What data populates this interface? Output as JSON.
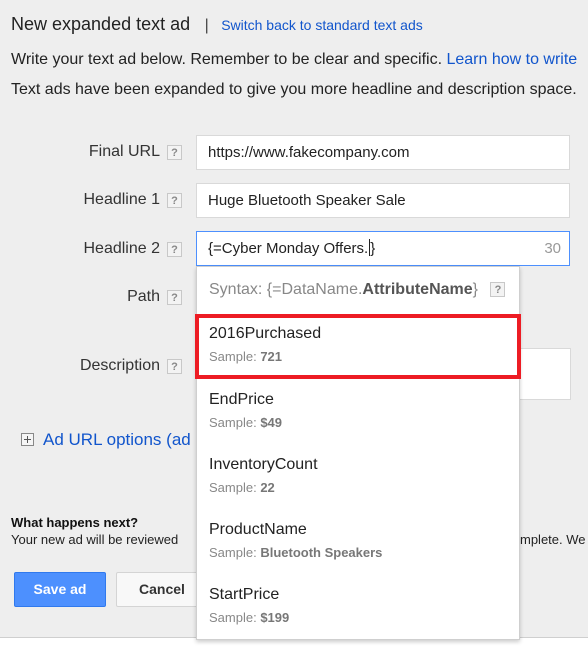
{
  "header": {
    "title": "New expanded text ad",
    "separator": "|",
    "switch_link": "Switch back to standard text ads"
  },
  "intro": {
    "line1_text": "Write your text ad below. Remember to be clear and specific.",
    "line1_link": "Learn how to write",
    "line2_text": "Text ads have been expanded to give you more headline and description space."
  },
  "help_glyph": "?",
  "form": {
    "final_url": {
      "label": "Final URL",
      "value": "https://www.fakecompany.com"
    },
    "headline1": {
      "label": "Headline 1",
      "value": "Huge Bluetooth Speaker Sale"
    },
    "headline2": {
      "label": "Headline 2",
      "value": "{=Cyber Monday Offers.",
      "value_after_caret": "}",
      "counter": "30"
    },
    "path": {
      "label": "Path"
    },
    "description": {
      "label": "Description"
    }
  },
  "ad_url_options": {
    "label": "Ad URL options (ad"
  },
  "dropdown": {
    "syntax_prefix": "Syntax: {=DataName.",
    "syntax_bold": "AttributeName",
    "syntax_suffix": "}",
    "sample_prefix": "Sample:",
    "highlight_color": "#ed1c24",
    "options": [
      {
        "name": "2016Purchased",
        "sample": "721",
        "highlighted": true
      },
      {
        "name": "EndPrice",
        "sample": "$49",
        "highlighted": false
      },
      {
        "name": "InventoryCount",
        "sample": "22",
        "highlighted": false
      },
      {
        "name": "ProductName",
        "sample": "Bluetooth Speakers",
        "highlighted": false
      },
      {
        "name": "StartPrice",
        "sample": "$199",
        "highlighted": false
      }
    ]
  },
  "next": {
    "title": "What happens next?",
    "text_left": "Your new ad will be reviewed",
    "text_right": "mplete. We"
  },
  "buttons": {
    "save": "Save ad",
    "cancel": "Cancel"
  },
  "colors": {
    "link": "#1155cc",
    "primary_button": "#4d90fe",
    "focus_border": "#4d90fe"
  }
}
